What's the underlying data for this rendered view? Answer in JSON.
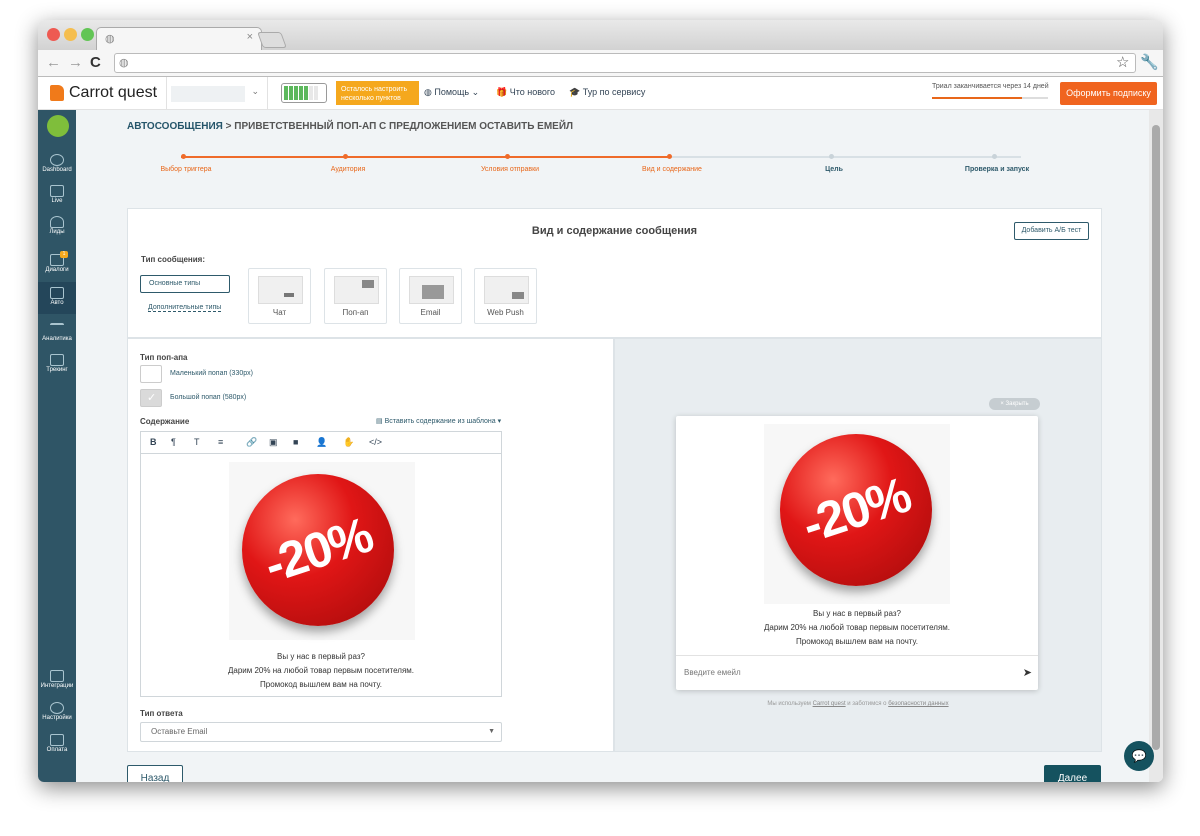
{
  "app": {
    "name": "Carrot quest"
  },
  "nav": {
    "setup_notice": "Осталось настроить несколько пунктов",
    "help": "Помощь",
    "whats_new": "Что нового",
    "tour": "Тур по сервису",
    "trial": "Триал заканчивается через 14 дней",
    "trial_progress": 0.78,
    "subscribe": "Оформить подписку"
  },
  "sidebar": {
    "items": [
      {
        "label": "Dashboard",
        "icon": "gauge-icon"
      },
      {
        "label": "Live",
        "icon": "pulse-icon"
      },
      {
        "label": "Лиды",
        "icon": "users-icon"
      },
      {
        "label": "Диалоги",
        "icon": "chat-icon",
        "badge": "1"
      },
      {
        "label": "Авто",
        "icon": "auto-message-icon"
      },
      {
        "label": "Аналитика",
        "icon": "analytics-icon"
      },
      {
        "label": "Трекинг",
        "icon": "cursor-icon"
      },
      {
        "label": "Интеграции",
        "icon": "puzzle-icon"
      },
      {
        "label": "Настройки",
        "icon": "gear-icon"
      },
      {
        "label": "Оплата",
        "icon": "card-icon"
      }
    ]
  },
  "breadcrumb": {
    "root": "АВТОСООБЩЕНИЯ",
    "current": "> ПРИВЕТСТВЕННЫЙ ПОП-АП С ПРЕДЛОЖЕНИЕМ ОСТАВИТЬ ЕМЕЙЛ"
  },
  "steps": [
    {
      "label": "Выбор триггера",
      "done": true
    },
    {
      "label": "Аудитория",
      "done": true
    },
    {
      "label": "Условия отправки",
      "done": true
    },
    {
      "label": "Вид и содержание",
      "done": true
    },
    {
      "label": "Цель",
      "done": false
    },
    {
      "label": "Проверка и запуск",
      "done": false
    }
  ],
  "section": {
    "title": "Вид и содержание сообщения",
    "ab_test": "Добавить А/Б тест",
    "type_label": "Тип сообщения:",
    "basic_types": "Основные типы",
    "extra_types": "Дополнительные типы",
    "types": [
      "Чат",
      "Поп-ап",
      "Email",
      "Web Push"
    ]
  },
  "editor": {
    "popup_type_label": "Тип поп-апа",
    "small_popup": "Маленький попап (330px)",
    "large_popup": "Большой попап (580px)",
    "content_label": "Содержание",
    "insert_template": "Вставить содержание из шаблона",
    "toolbar": [
      "B",
      "¶",
      "T",
      "≡",
      "🔗",
      "▣",
      "■",
      "👤",
      "✋",
      "</>"
    ],
    "sticker_text": "-20%",
    "line1": "Вы у нас в первый раз?",
    "line2": "Дарим 20% на любой товар первым посетителям.",
    "line3": "Промокод вышлем вам на почту.",
    "answer_type_label": "Тип ответа",
    "answer_type_value": "Оставьте Email"
  },
  "preview": {
    "close": "Закрыть",
    "email_placeholder": "Введите емейл",
    "disclaimer_pre": "Мы используем",
    "disclaimer_link1": "Carrot quest",
    "disclaimer_mid": "и заботимся о",
    "disclaimer_link2": "безопасности данных"
  },
  "footer": {
    "back": "Назад",
    "next": "Далее"
  },
  "colors": {
    "accent": "#f0641f",
    "primary": "#15525f",
    "sidebar": "#2f5566"
  }
}
